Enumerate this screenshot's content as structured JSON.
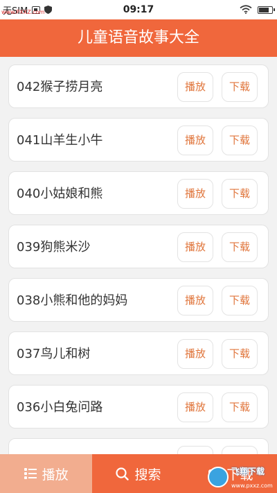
{
  "status_bar": {
    "carrier": "无SIM",
    "time": "09:17",
    "watermark_url": "www.PXXZ.com"
  },
  "header": {
    "title": "儿童语音故事大全"
  },
  "stories": [
    {
      "title": "042猴子捞月亮",
      "play_label": "播放",
      "download_label": "下载"
    },
    {
      "title": "041山羊生小牛",
      "play_label": "播放",
      "download_label": "下载"
    },
    {
      "title": "040小姑娘和熊",
      "play_label": "播放",
      "download_label": "下载"
    },
    {
      "title": "039狗熊米沙",
      "play_label": "播放",
      "download_label": "下载"
    },
    {
      "title": "038小熊和他的妈妈",
      "play_label": "播放",
      "download_label": "下载"
    },
    {
      "title": "037鸟儿和树",
      "play_label": "播放",
      "download_label": "下载"
    },
    {
      "title": "036小白兔问路",
      "play_label": "播放",
      "download_label": "下载"
    },
    {
      "title": "",
      "play_label": "",
      "download_label": ""
    }
  ],
  "tabbar": {
    "tabs": [
      {
        "label": "播放",
        "icon": "list-icon",
        "active": true
      },
      {
        "label": "搜索",
        "icon": "search-icon",
        "active": false
      },
      {
        "label": "下载",
        "icon": "download-icon",
        "active": false
      }
    ]
  },
  "watermark_logo": {
    "text": "飞翔下载",
    "sub": "www.pxxz.com"
  },
  "colors": {
    "accent": "#f0673c",
    "button_text": "#e0743a",
    "active_tab": "#f2ad8f"
  }
}
